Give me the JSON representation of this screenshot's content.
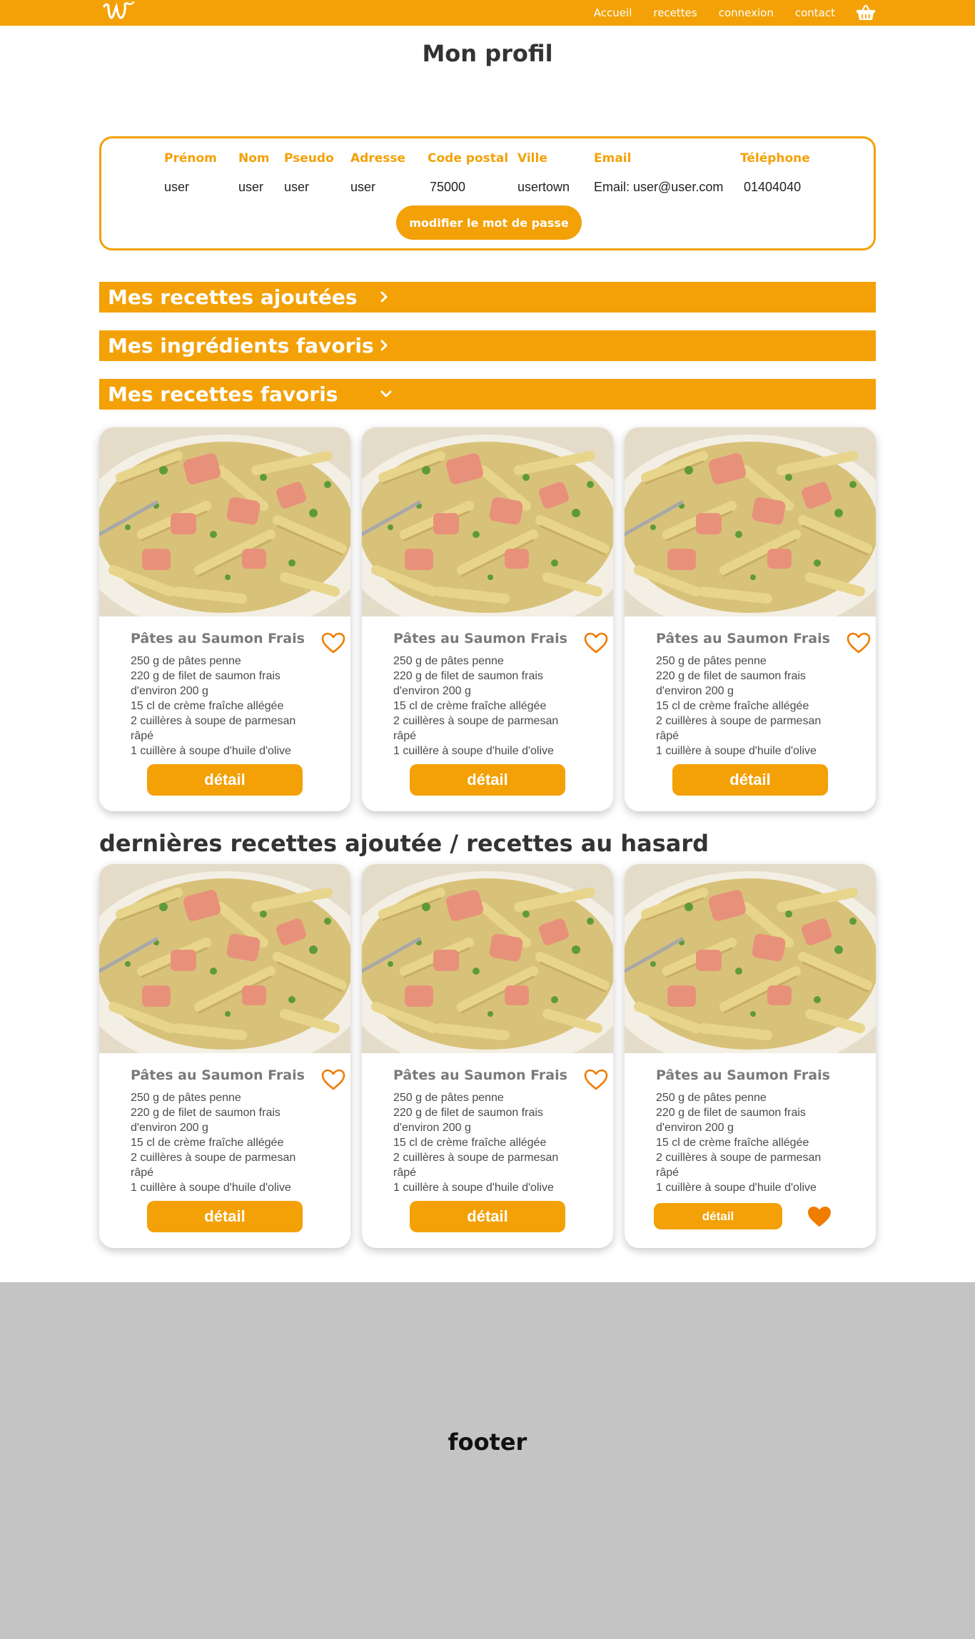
{
  "nav": {
    "links": [
      "Accueil",
      "recettes",
      "connexion",
      "contact"
    ],
    "logo_icon": "script-w-logo",
    "cart_icon": "basket-icon"
  },
  "page_title": "Mon profil",
  "profile": {
    "columns": [
      {
        "label": "Prénom",
        "value": "user"
      },
      {
        "label": "Nom",
        "value": "user"
      },
      {
        "label": "Pseudo",
        "value": "user"
      },
      {
        "label": "Adresse",
        "value": "user"
      },
      {
        "label": "Code postal",
        "value": "75000"
      },
      {
        "label": "Ville",
        "value": "usertown"
      },
      {
        "label": "Email",
        "value": "Email: user@user.com"
      },
      {
        "label": "Téléphone",
        "value": "01404040"
      }
    ],
    "password_button": "modifier le mot de passe"
  },
  "sections": {
    "added": "Mes recettes ajoutées",
    "ingredients": "Mes ingrédients favoris",
    "favorites": "Mes recettes favoris"
  },
  "latest_title": "dernières recettes ajoutée / recettes au hasard",
  "recipe": {
    "title": "Pâtes au Saumon Frais",
    "ingredients": [
      "250 g de pâtes penne",
      "220 g de filet de saumon frais d'environ 200 g",
      "15 cl de crème fraîche allégée",
      "2 cuillères à soupe de parmesan râpé",
      "1 cuillère à soupe d'huile d'olive"
    ],
    "detail_label": "détail"
  },
  "footer": "footer",
  "colors": {
    "accent": "#f3a107",
    "heart": "#f07c00",
    "footer_bg": "#c4c4c4"
  }
}
